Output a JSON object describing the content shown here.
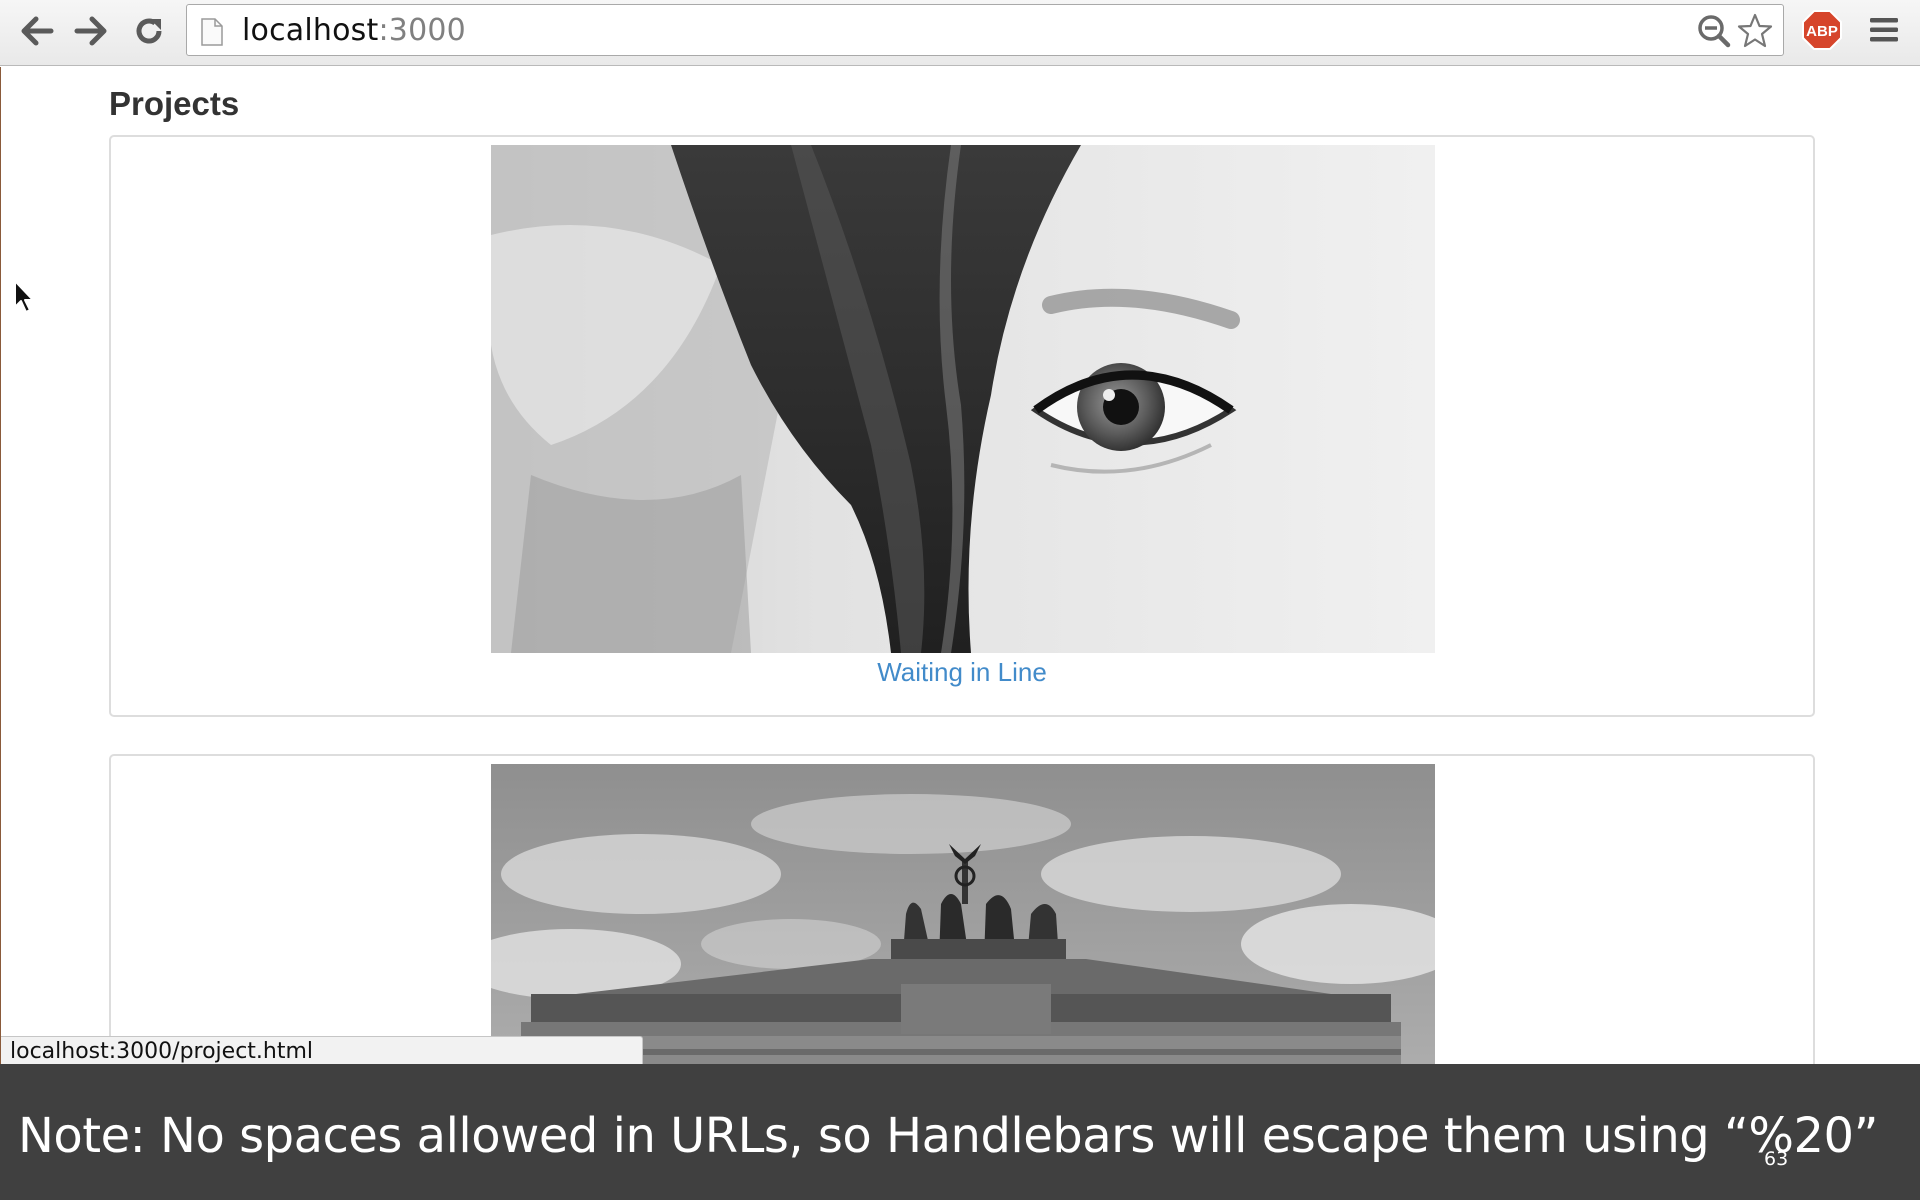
{
  "browser": {
    "url_host": "localhost",
    "url_port": ":3000",
    "status_url": "localhost:3000/project.html"
  },
  "page": {
    "title": "Projects",
    "projects": [
      {
        "title": "Waiting in Line"
      },
      {
        "title": ""
      }
    ]
  },
  "caption": {
    "text": "Note: No spaces allowed in URLs, so Handlebars will escape them using “%20”",
    "slide_number": "63"
  },
  "icons": {
    "back": "back-arrow-icon",
    "forward": "forward-arrow-icon",
    "reload": "reload-icon",
    "page": "page-icon",
    "zoom": "zoom-out-icon",
    "star": "bookmark-star-icon",
    "adblock": "adblock-plus-icon",
    "menu": "hamburger-menu-icon"
  },
  "colors": {
    "link": "#428bca",
    "caption_bg": "#404040",
    "abp_red": "#d6452b"
  }
}
